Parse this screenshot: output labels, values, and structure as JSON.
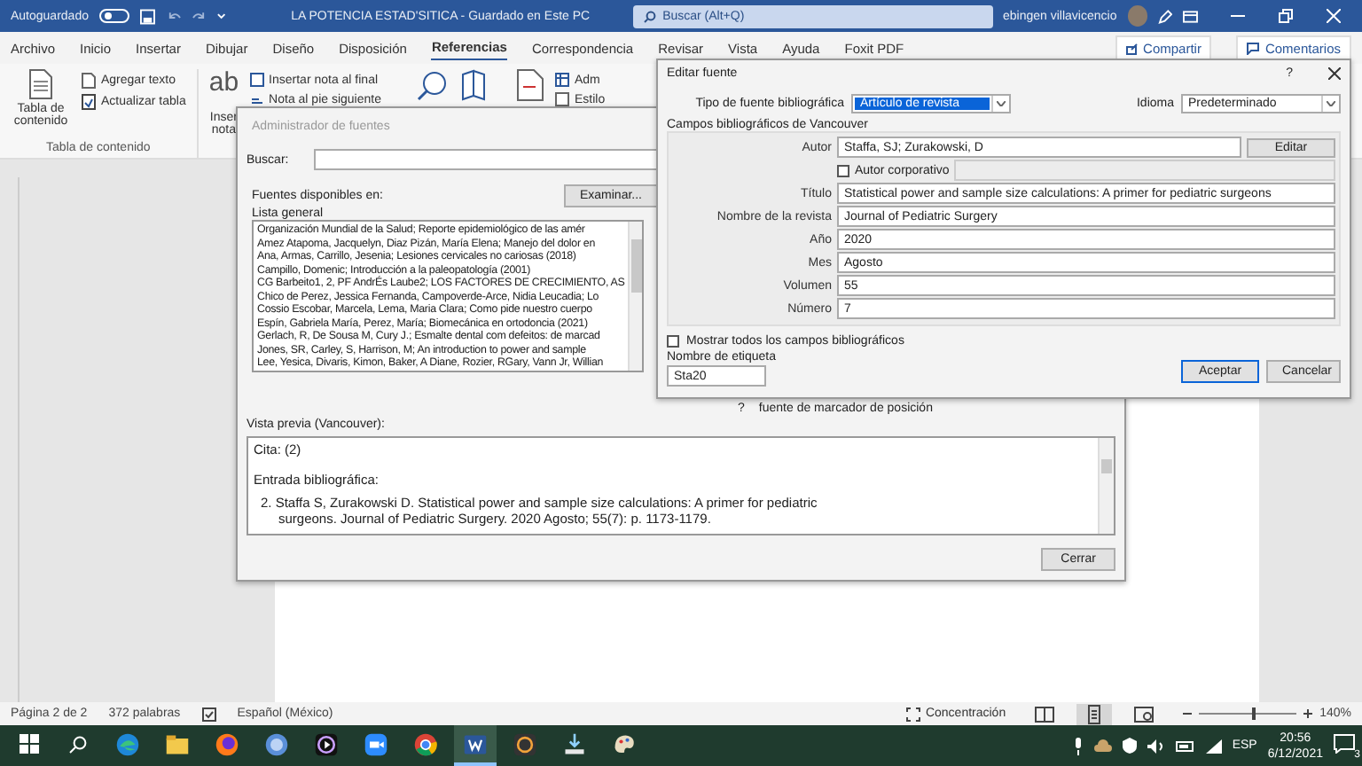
{
  "titlebar": {
    "autosave_label": "Autoguardado",
    "autosave_on": false,
    "document_title": "LA POTENCIA ESTAD'SITICA  -  Guardado en Este PC",
    "search_placeholder": "Buscar (Alt+Q)",
    "user_name": "ebingen villavicencio"
  },
  "menu": {
    "tabs": [
      {
        "label": "Archivo",
        "selected": false
      },
      {
        "label": "Inicio",
        "selected": false
      },
      {
        "label": "Insertar",
        "selected": false
      },
      {
        "label": "Dibujar",
        "selected": false
      },
      {
        "label": "Diseño",
        "selected": false
      },
      {
        "label": "Disposición",
        "selected": false
      },
      {
        "label": "Referencias",
        "selected": true
      },
      {
        "label": "Correspondencia",
        "selected": false
      },
      {
        "label": "Revisar",
        "selected": false
      },
      {
        "label": "Vista",
        "selected": false
      },
      {
        "label": "Ayuda",
        "selected": false
      },
      {
        "label": "Foxit PDF",
        "selected": false
      }
    ],
    "share": "Compartir",
    "comments": "Comentarios"
  },
  "ribbon": {
    "toc_button": "Tabla de contenido",
    "add_text": "Agregar texto",
    "update_table": "Actualizar tabla",
    "toc_group": "Tabla de contenido",
    "footnote_glyph": "ab",
    "footnote_clip": "Inser",
    "footnote_clip_2": "nota",
    "endnote": "Insertar nota al final",
    "next_footnote": "Nota al pie siguiente",
    "manage_clip": "Adm",
    "style_clip": "Estilo"
  },
  "source_manager": {
    "title": "Administrador de fuentes",
    "search_label": "Buscar:",
    "available_label": "Fuentes disponibles en:",
    "list_name": "Lista general",
    "browse_button": "Examinar...",
    "sources": [
      "Organización Mundial de la Salud; Reporte epidemiológico de las amér",
      "Amez Atapoma, Jacquelyn, Diaz Pizán, María Elena; Manejo del dolor en",
      "Ana, Armas, Carrillo, Jesenia; Lesiones cervicales no cariosas (2018)",
      "Campillo, Domenic; Introducción a la paleopatología (2001)",
      "CG Barbeito1, 2, PF AndrÉs Laube2; LOS FACTORES DE CRECIMIENTO, AS",
      "Chico de Perez, Jessica Fernanda, Campoverde-Arce, Nidia Leucadia; Lo",
      "Cossio Escobar, Marcela, Lema, Maria Clara; Como pide nuestro cuerpo",
      "Espín, Gabriela María, Perez, María; Biomecánica en ortodoncia (2021)",
      "Gerlach, R, De Sousa M, Cury J.; Esmalte dental com defeitos: de marcad",
      "Jones, SR, Carley, S, Harrison, M; An introduction to power and sample",
      "Lee, Yesica, Divaris, Kimon, Baker, A Diane, Rozier, RGary, Vann Jr, Willian"
    ],
    "placeholder_mark": "?",
    "placeholder_text": "fuente de marcador de posición",
    "preview_label": "Vista previa (Vancouver):",
    "citation": "Cita:  (2)",
    "entry_label": "Entrada bibliográfica:",
    "entry": "2. Staffa S, Zurakowski D. Statistical power and sample size calculations: A primer for pediatric surgeons. Journal of Pediatric Surgery. 2020 Agosto; 55(7): p. 1173-1179.",
    "close_button": "Cerrar"
  },
  "edit_source": {
    "title": "Editar fuente",
    "help": "?",
    "type_label": "Tipo de fuente bibliográfica",
    "type_value": "Artículo de revista",
    "language_label": "Idioma",
    "language_value": "Predeterminado",
    "group_label": "Campos bibliográficos de Vancouver",
    "author_label": "Autor",
    "author_value": "Staffa, SJ; Zurakowski, D",
    "edit_button": "Editar",
    "corporate_label": "Autor corporativo",
    "corporate_checked": false,
    "fields": [
      {
        "label": "Título",
        "value": "Statistical power and sample size calculations: A primer for pediatric surgeons"
      },
      {
        "label": "Nombre de la revista",
        "value": "Journal of Pediatric Surgery"
      },
      {
        "label": "Año",
        "value": "2020"
      },
      {
        "label": "Mes",
        "value": "Agosto"
      },
      {
        "label": "Volumen",
        "value": "55"
      },
      {
        "label": "Número",
        "value": "7"
      }
    ],
    "show_all_label": "Mostrar todos los campos bibliográficos",
    "show_all_checked": false,
    "tag_label": "Nombre de etiqueta",
    "tag_value": "Sta20",
    "ok_button": "Aceptar",
    "cancel_button": "Cancelar"
  },
  "status_bar": {
    "page": "Página 2 de 2",
    "words": "372 palabras",
    "language": "Español (México)",
    "focus": "Concentración",
    "views": [
      {
        "kind": "read",
        "selected": false
      },
      {
        "kind": "print",
        "selected": true
      },
      {
        "kind": "web",
        "selected": false
      }
    ],
    "zoom": {
      "level": 0.57,
      "reading": "140%"
    }
  },
  "taskbar": {
    "apps": [
      {
        "kind": "edge",
        "selected": false
      },
      {
        "kind": "files",
        "selected": false
      },
      {
        "kind": "firefox",
        "selected": false
      },
      {
        "kind": "globe",
        "selected": false
      },
      {
        "kind": "media",
        "selected": false
      },
      {
        "kind": "zoom",
        "selected": false
      },
      {
        "kind": "chrome",
        "selected": false
      },
      {
        "kind": "word",
        "selected": true
      },
      {
        "kind": "check",
        "selected": false
      },
      {
        "kind": "download",
        "selected": false
      },
      {
        "kind": "paint",
        "selected": false
      }
    ],
    "language": "ESP",
    "time": "20:56",
    "date": "6/12/2021",
    "notifications": "3"
  }
}
